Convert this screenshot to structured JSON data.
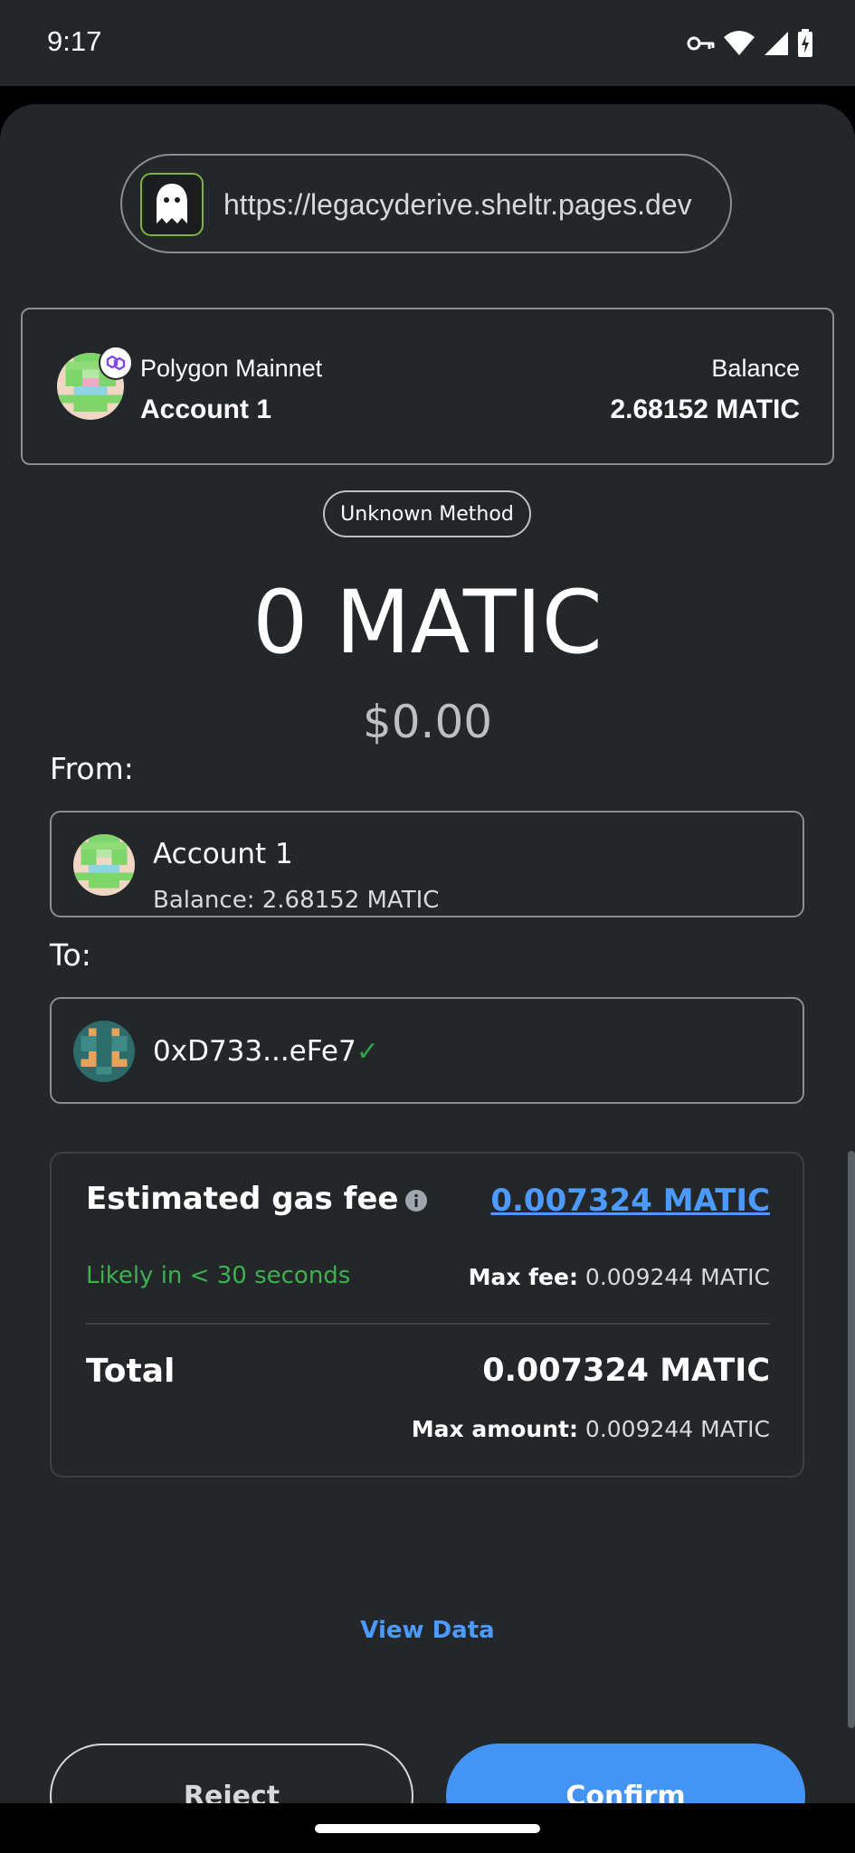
{
  "status_bar": {
    "time": "9:17"
  },
  "site": {
    "url": "https://legacyderive.sheltr.pages.dev"
  },
  "account_header": {
    "network": "Polygon Mainnet",
    "account": "Account 1",
    "balance_label": "Balance",
    "balance_value": "2.68152 MATIC"
  },
  "method": "Unknown Method",
  "amount": {
    "value": "0 MATIC",
    "fiat": "$0.00"
  },
  "from": {
    "label": "From:",
    "name": "Account 1",
    "balance": "Balance: 2.68152 MATIC"
  },
  "to": {
    "label": "To:",
    "address": "0xD733...eFe7",
    "check": "✓"
  },
  "gas": {
    "title": "Estimated gas fee",
    "value": "0.007324 MATIC",
    "timing": "Likely in < 30 seconds",
    "max_fee_label": "Max fee:",
    "max_fee_value": "0.009244 MATIC"
  },
  "total": {
    "label": "Total",
    "value": "0.007324 MATIC",
    "max_amount_label": "Max amount:",
    "max_amount_value": "0.009244 MATIC"
  },
  "links": {
    "view_data": "View Data"
  },
  "buttons": {
    "reject": "Reject",
    "confirm": "Confirm"
  },
  "colors": {
    "background": "#24272a",
    "accent": "#4394f4",
    "link": "#4c9aff",
    "success": "#3faf52"
  }
}
